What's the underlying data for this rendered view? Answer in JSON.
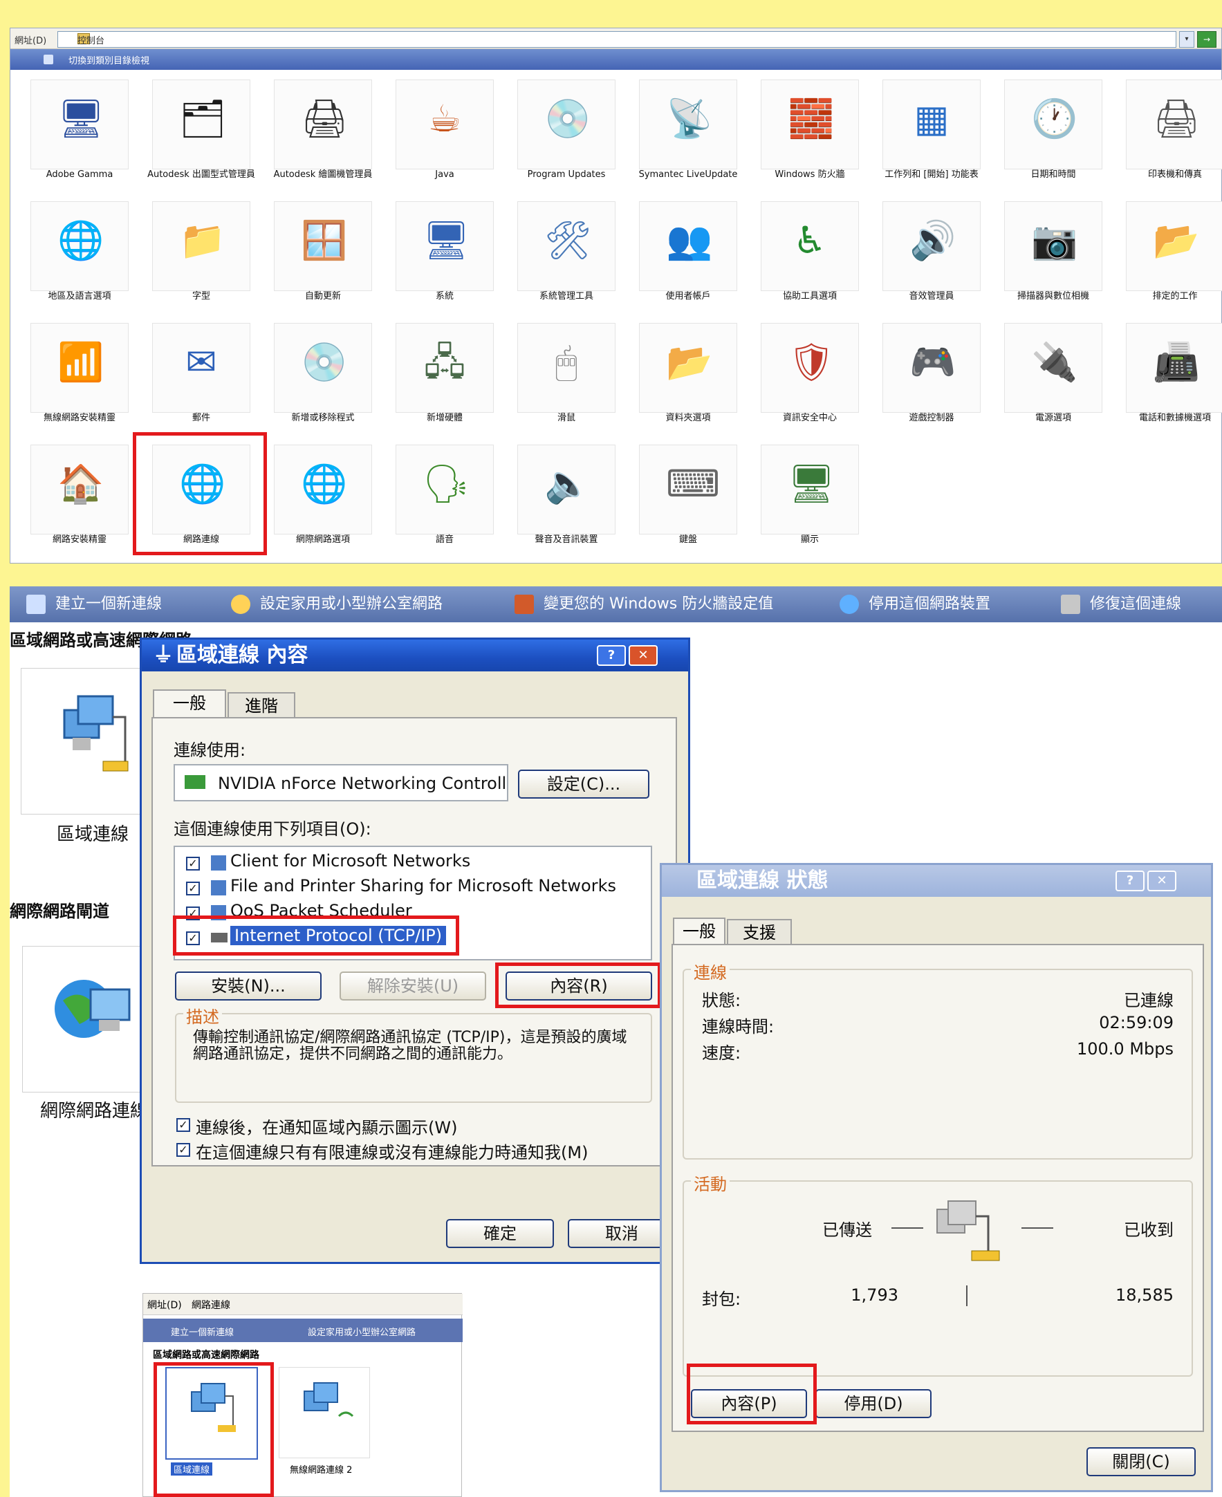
{
  "control_panel": {
    "address_label": "網址(D)",
    "address_value": "控制台",
    "go_label": "→",
    "dropdown_label": "▾",
    "header_link": "切換到類別目錄檢視",
    "items": [
      {
        "label": "Adobe Gamma",
        "icon": "monitor-icon",
        "glyph": "🖥",
        "color": "#2b4f9e"
      },
      {
        "label": "Autodesk 出圖型式管理員",
        "icon": "autodesk-plot-icon",
        "glyph": "🗂",
        "color": "#1a1a1a"
      },
      {
        "label": "Autodesk 繪圖機管理員",
        "icon": "autodesk-plotter-icon",
        "glyph": "🖨",
        "color": "#333"
      },
      {
        "label": "Java",
        "icon": "java-icon",
        "glyph": "☕",
        "color": "#c7541b"
      },
      {
        "label": "Program Updates",
        "icon": "program-updates-icon",
        "glyph": "💿",
        "color": "#0d2a5b"
      },
      {
        "label": "Symantec LiveUpdate",
        "icon": "liveupdate-icon",
        "glyph": "📡",
        "color": "#e6a300"
      },
      {
        "label": "Windows 防火牆",
        "icon": "firewall-icon",
        "glyph": "🧱",
        "color": "#b24c22"
      },
      {
        "label": "工作列和 [開始] 功能表",
        "icon": "taskbar-icon",
        "glyph": "▦",
        "color": "#2b6fc7"
      },
      {
        "label": "日期和時間",
        "icon": "datetime-icon",
        "glyph": "🕐",
        "color": "#3a6fb0"
      },
      {
        "label": "印表機和傳真",
        "icon": "printer-icon",
        "glyph": "🖨",
        "color": "#555"
      },
      {
        "label": "地區及語言選項",
        "icon": "globe-icon",
        "glyph": "🌐",
        "color": "#2a7ad4"
      },
      {
        "label": "字型",
        "icon": "fonts-folder-icon",
        "glyph": "📁",
        "color": "#d7a82a"
      },
      {
        "label": "自動更新",
        "icon": "windows-update-icon",
        "glyph": "🪟",
        "color": "#3c8a2a"
      },
      {
        "label": "系統",
        "icon": "system-icon",
        "glyph": "🖥",
        "color": "#3364b5"
      },
      {
        "label": "系統管理工具",
        "icon": "admin-tools-icon",
        "glyph": "🛠",
        "color": "#4979b8"
      },
      {
        "label": "使用者帳戶",
        "icon": "user-accounts-icon",
        "glyph": "👥",
        "color": "#c0392b"
      },
      {
        "label": "協助工具選項",
        "icon": "accessibility-icon",
        "glyph": "♿",
        "color": "#238a2f"
      },
      {
        "label": "音效管理員",
        "icon": "sound-manager-icon",
        "glyph": "🔊",
        "color": "#1a2a9a"
      },
      {
        "label": "掃描器與數位相機",
        "icon": "scanner-icon",
        "glyph": "📷",
        "color": "#555"
      },
      {
        "label": "排定的工作",
        "icon": "scheduled-tasks-icon",
        "glyph": "📂",
        "color": "#d6a52a"
      },
      {
        "label": "無線網路安裝精靈",
        "icon": "wireless-setup-icon",
        "glyph": "📶",
        "color": "#2b7a2b"
      },
      {
        "label": "郵件",
        "icon": "mail-icon",
        "glyph": "✉",
        "color": "#2b5fb8"
      },
      {
        "label": "新增或移除程式",
        "icon": "add-remove-programs-icon",
        "glyph": "💿",
        "color": "#444"
      },
      {
        "label": "新增硬體",
        "icon": "add-hardware-icon",
        "glyph": "🖧",
        "color": "#4a6a4a"
      },
      {
        "label": "滑鼠",
        "icon": "mouse-icon",
        "glyph": "🖱",
        "color": "#888"
      },
      {
        "label": "資料夾選項",
        "icon": "folder-options-icon",
        "glyph": "📂",
        "color": "#d6a52a"
      },
      {
        "label": "資訊安全中心",
        "icon": "security-center-icon",
        "glyph": "🛡",
        "color": "#c0392b"
      },
      {
        "label": "遊戲控制器",
        "icon": "game-controller-icon",
        "glyph": "🎮",
        "color": "#4a6aa5"
      },
      {
        "label": "電源選項",
        "icon": "power-options-icon",
        "glyph": "🔌",
        "color": "#b8860b"
      },
      {
        "label": "電話和數據機選項",
        "icon": "phone-modem-icon",
        "glyph": "📠",
        "color": "#555"
      },
      {
        "label": "網路安裝精靈",
        "icon": "network-setup-icon",
        "glyph": "🏠",
        "color": "#c0392b"
      },
      {
        "label": "網路連線",
        "icon": "network-connections-icon",
        "glyph": "🌐",
        "color": "#2a7ad4"
      },
      {
        "label": "網際網路選項",
        "icon": "internet-options-icon",
        "glyph": "🌐",
        "color": "#2a7ad4"
      },
      {
        "label": "語音",
        "icon": "speech-icon",
        "glyph": "🗣",
        "color": "#3c8a2a"
      },
      {
        "label": "聲音及音訊裝置",
        "icon": "sound-devices-icon",
        "glyph": "🔈",
        "color": "#555"
      },
      {
        "label": "鍵盤",
        "icon": "keyboard-icon",
        "glyph": "⌨",
        "color": "#666"
      },
      {
        "label": "顯示",
        "icon": "display-icon",
        "glyph": "🖥",
        "color": "#3a7a3a"
      }
    ]
  },
  "network_window": {
    "tasks": [
      {
        "label": "建立一個新連線",
        "color": "#cfe0ff"
      },
      {
        "label": "設定家用或小型辦公室網路",
        "color": "#ffd257"
      },
      {
        "label": "變更您的 Windows 防火牆設定值",
        "color": "#d25a2a"
      },
      {
        "label": "停用這個網路裝置",
        "color": "#5fb0ff"
      },
      {
        "label": "修復這個連線",
        "color": "#c7c7c7"
      }
    ],
    "section_lan": "區域網路或高速網際網路",
    "lan_caption": "區域連線",
    "section_inet": "網際網路閘道",
    "inet_caption": "網際網路連線"
  },
  "properties_dialog": {
    "title": "區域連線 內容",
    "help_btn": "?",
    "close_btn": "✕",
    "tabs": [
      "一般",
      "進階"
    ],
    "connect_using_label": "連線使用:",
    "adapter_name": "NVIDIA nForce Networking Controll",
    "configure_btn": "設定(C)...",
    "items_label": "這個連線使用下列項目(O):",
    "items": [
      {
        "label": "Client for Microsoft Networks",
        "checked": true
      },
      {
        "label": "File and Printer Sharing for Microsoft Networks",
        "checked": true
      },
      {
        "label": "QoS Packet Scheduler",
        "checked": true
      },
      {
        "label": "Internet Protocol (TCP/IP)",
        "checked": true,
        "selected": true
      }
    ],
    "install_btn": "安裝(N)...",
    "uninstall_btn": "解除安裝(U)",
    "properties_btn": "內容(R)",
    "description_title": "描述",
    "description_text": "傳輸控制通訊協定/網際網路通訊協定 (TCP/IP)，這是預設的廣域網路通訊協定，提供不同網路之間的通訊能力。",
    "option1": "連線後，在通知區域內顯示圖示(W)",
    "option2": "在這個連線只有有限連線或沒有連線能力時通知我(M)",
    "ok_btn": "確定",
    "cancel_btn": "取消"
  },
  "status_dialog": {
    "title": "區域連線 狀態",
    "help_btn": "?",
    "close_btn": "✕",
    "tabs": [
      "一般",
      "支援"
    ],
    "connection_group": "連線",
    "status_label": "狀態:",
    "status_value": "已連線",
    "duration_label": "連線時間:",
    "duration_value": "02:59:09",
    "speed_label": "速度:",
    "speed_value": "100.0 Mbps",
    "activity_group": "活動",
    "sent_label": "已傳送",
    "received_label": "已收到",
    "packets_label": "封包:",
    "sent_value": "1,793",
    "received_value": "18,585",
    "properties_btn": "內容(P)",
    "disable_btn": "停用(D)",
    "close_label": "關閉(C)"
  },
  "thumbnail": {
    "address_label": "網址(D)",
    "address_value": "網路連線",
    "task1": "建立一個新連線",
    "task2": "設定家用或小型辦公室網路",
    "section": "區域網路或高速網際網路",
    "item1": "區域連線",
    "item2": "無線網路連線 2"
  }
}
